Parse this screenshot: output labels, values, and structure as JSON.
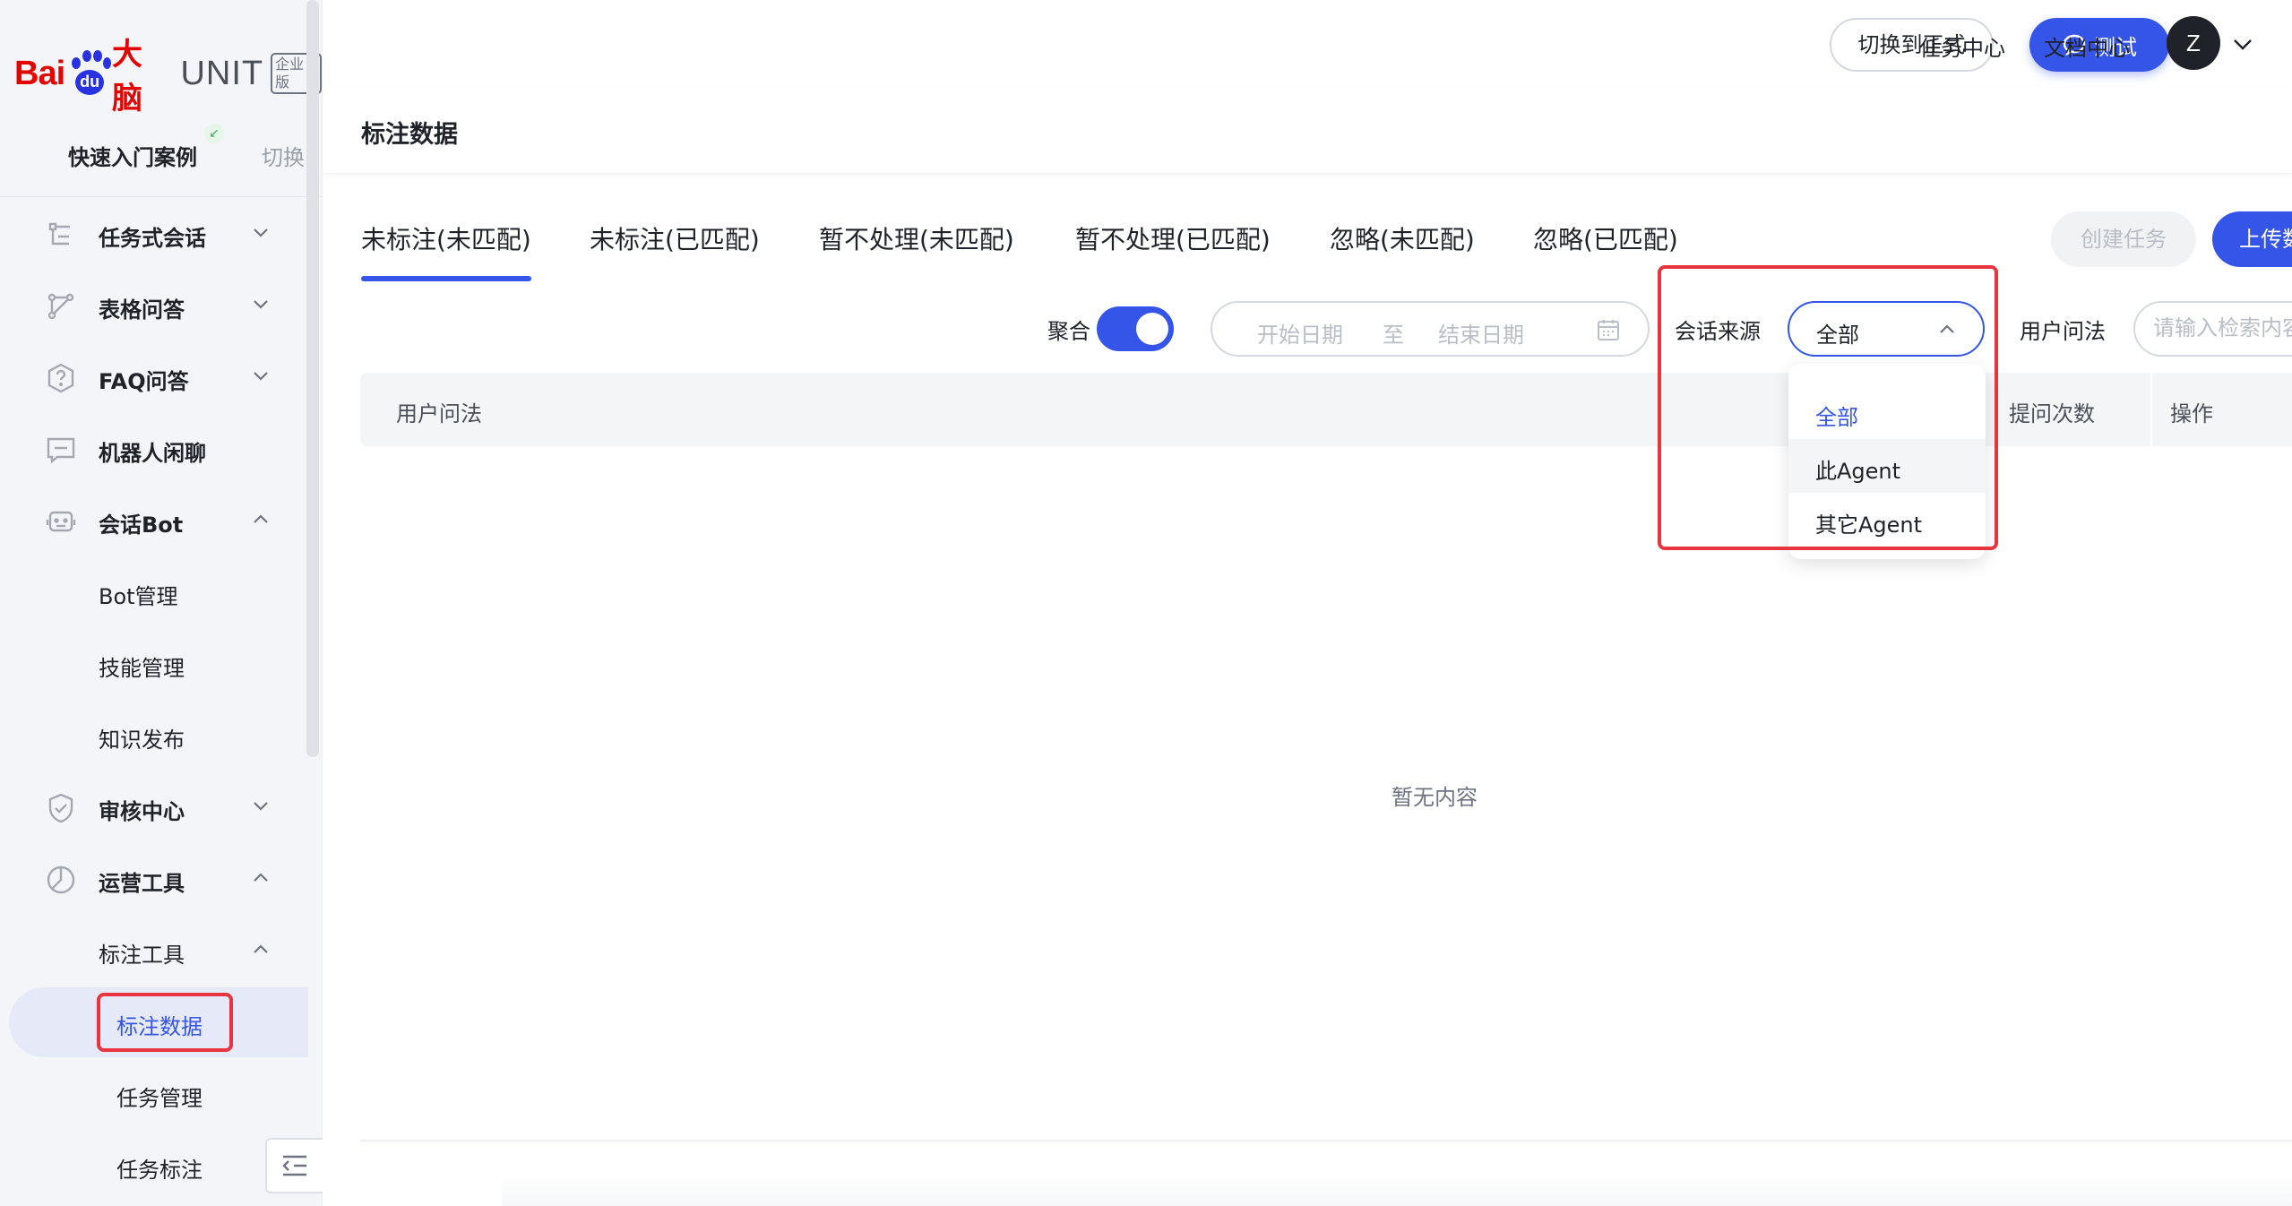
{
  "app": {
    "logo": {
      "bai": "Bai",
      "du": "du",
      "danao": "大脑",
      "unit": "UNIT",
      "edition": "企业版"
    }
  },
  "project": {
    "name": "快速入门案例",
    "switch_label": "切换"
  },
  "sidebar": {
    "items": [
      {
        "label": "任务式会话",
        "icon": "task-dialog-icon",
        "expanded": false
      },
      {
        "label": "表格问答",
        "icon": "table-qa-icon",
        "expanded": false
      },
      {
        "label": "FAQ问答",
        "icon": "faq-icon",
        "expanded": false
      },
      {
        "label": "机器人闲聊",
        "icon": "chat-icon"
      },
      {
        "label": "会话Bot",
        "icon": "bot-icon",
        "expanded": true
      },
      {
        "label": "审核中心",
        "icon": "shield-icon",
        "expanded": false
      },
      {
        "label": "运营工具",
        "icon": "ops-icon",
        "expanded": true
      }
    ],
    "bot_children": [
      "Bot管理",
      "技能管理",
      "知识发布"
    ],
    "ops_children": {
      "label": "标注工具"
    },
    "annot_children": [
      "标注数据",
      "任务管理",
      "任务标注"
    ],
    "active": "标注数据"
  },
  "header": {
    "switch_label": "切换到正式",
    "test_label": "测试",
    "task_center": "任务中心",
    "doc_center": "文档中心",
    "avatar_initial": "Z"
  },
  "page": {
    "title": "标注数据"
  },
  "tabs": {
    "items": [
      "未标注(未匹配)",
      "未标注(已匹配)",
      "暂不处理(未匹配)",
      "暂不处理(已匹配)",
      "忽略(未匹配)",
      "忽略(已匹配)"
    ],
    "active_index": 0,
    "create_task": "创建任务",
    "upload": "上传数"
  },
  "filters": {
    "aggregate_label": "聚合",
    "aggregate_on": true,
    "date_start_placeholder": "开始日期",
    "date_sep": "至",
    "date_end_placeholder": "结束日期",
    "source_label": "会话来源",
    "source_value": "全部",
    "query_label": "用户问法",
    "query_placeholder": "请输入检索内容"
  },
  "table": {
    "columns": [
      "用户问法",
      "提问次数",
      "操作"
    ],
    "empty_text": "暂无内容"
  },
  "dropdown": {
    "options": [
      "全部",
      "此Agent",
      "其它Agent"
    ],
    "selected_index": 0,
    "hover_index": 1
  },
  "colors": {
    "accent": "#3555e8",
    "highlight": "#e8343f",
    "sidebar_bg": "#f4f5f8"
  }
}
